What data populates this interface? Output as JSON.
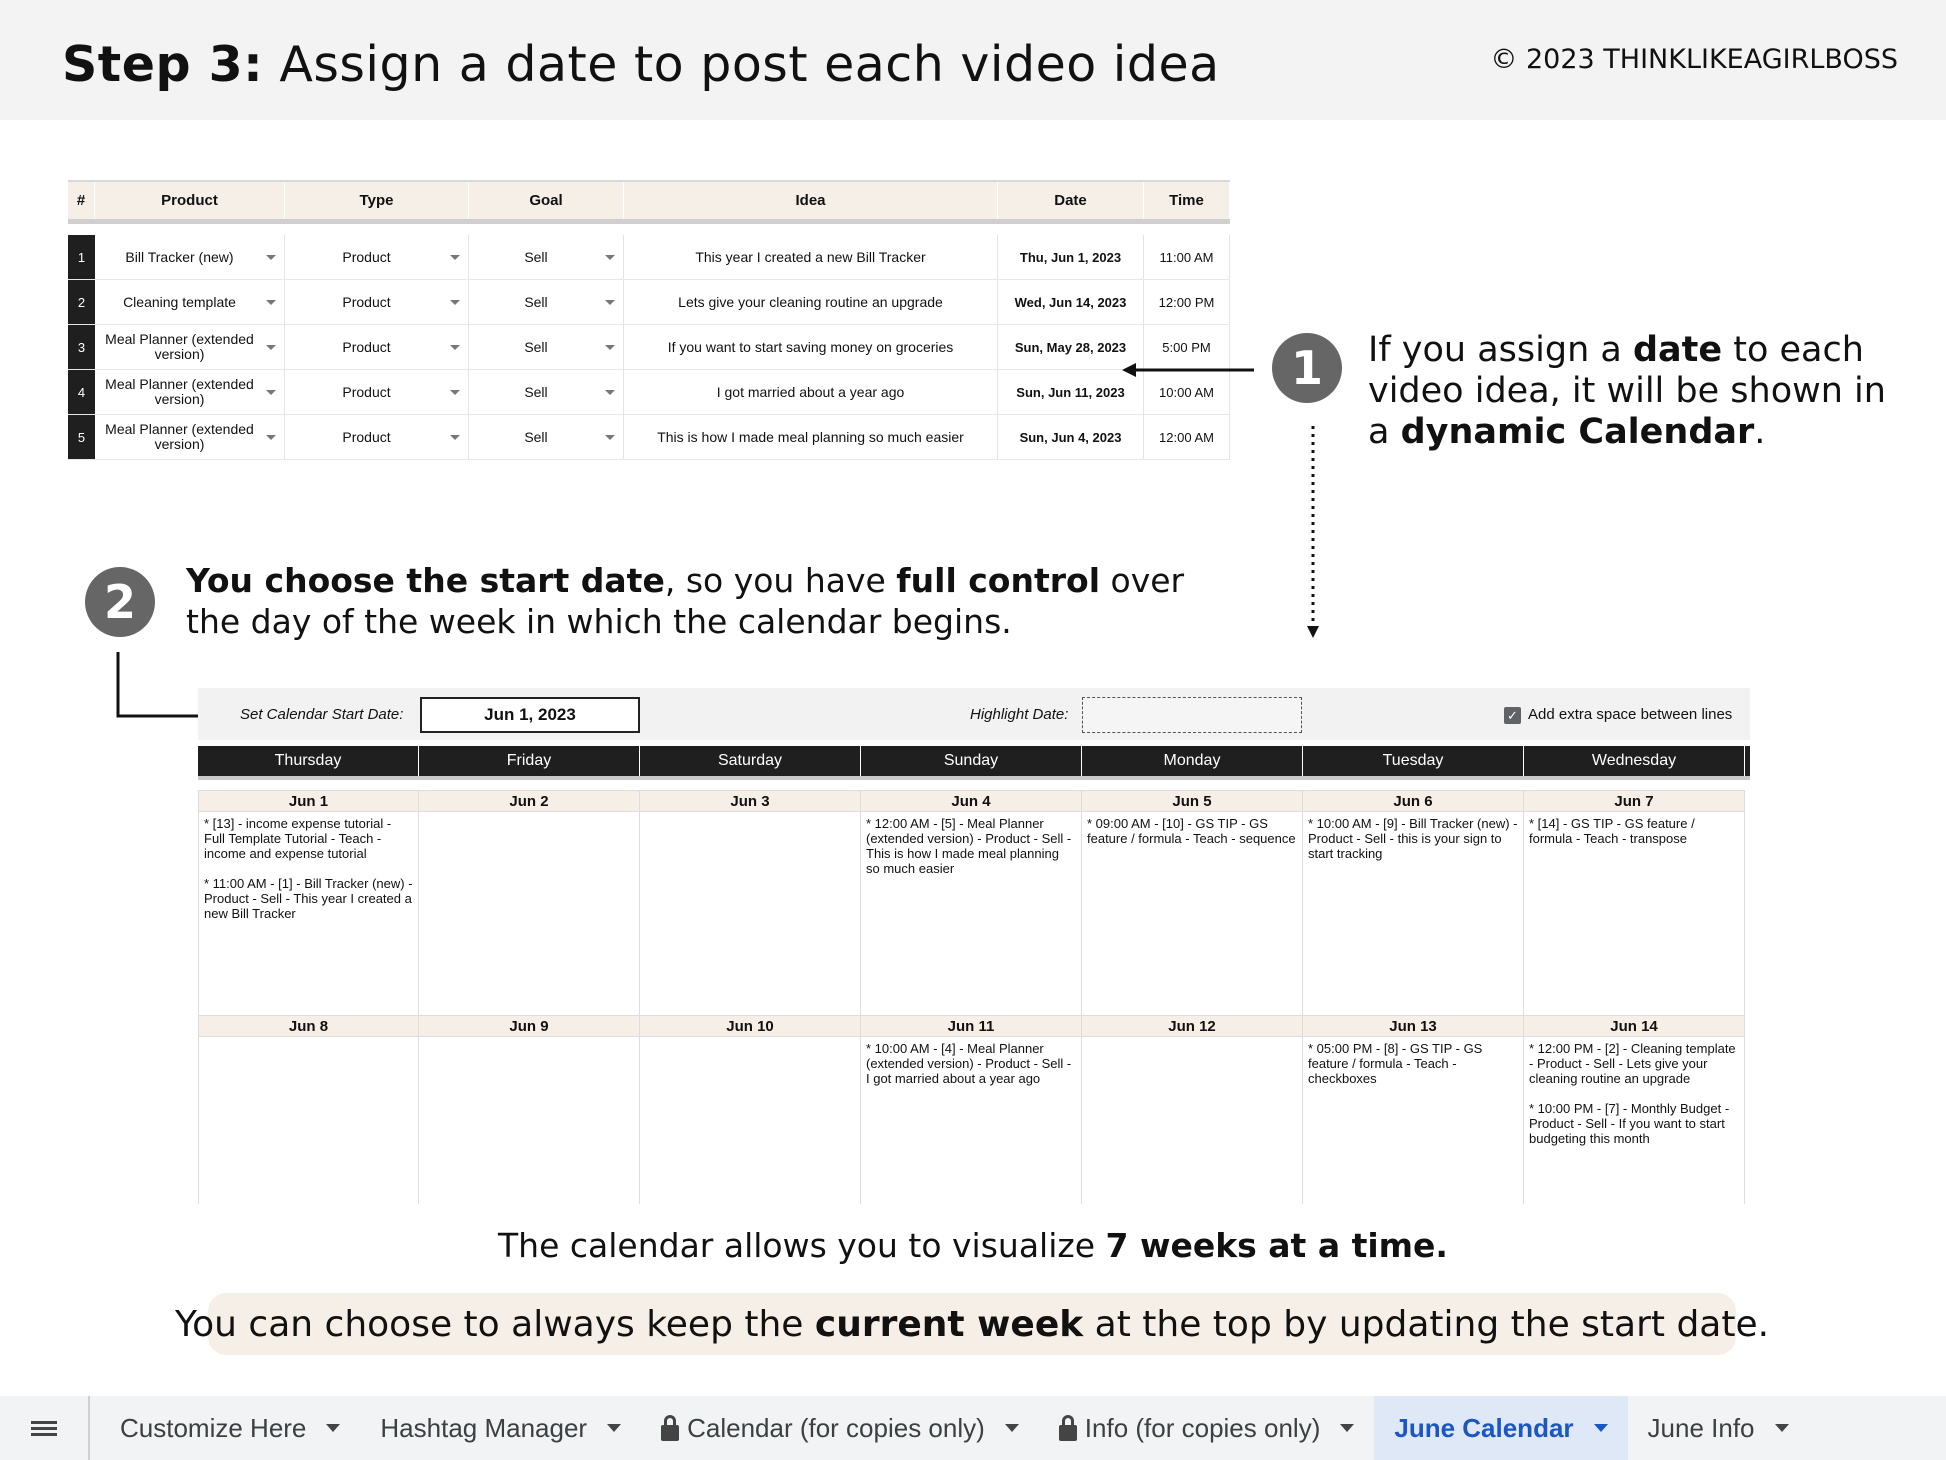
{
  "header": {
    "step_label": "Step 3:",
    "step_text": "Assign a date to post each video idea",
    "copyright": "©  2023 THINKLIKEAGIRLBOSS"
  },
  "table": {
    "headers": [
      "#",
      "Product",
      "Type",
      "Goal",
      "Idea",
      "Date",
      "Time"
    ],
    "rows": [
      {
        "num": "1",
        "product": "Bill Tracker (new)",
        "type": "Product",
        "goal": "Sell",
        "idea": "This year I created a new Bill Tracker",
        "date": "Thu, Jun 1, 2023",
        "time": "11:00 AM"
      },
      {
        "num": "2",
        "product": "Cleaning template",
        "type": "Product",
        "goal": "Sell",
        "idea": "Lets give your cleaning routine an upgrade",
        "date": "Wed, Jun 14, 2023",
        "time": "12:00 PM"
      },
      {
        "num": "3",
        "product": "Meal Planner (extended version)",
        "type": "Product",
        "goal": "Sell",
        "idea": "If you want to start saving money on groceries",
        "date": "Sun, May 28, 2023",
        "time": "5:00 PM"
      },
      {
        "num": "4",
        "product": "Meal Planner (extended version)",
        "type": "Product",
        "goal": "Sell",
        "idea": "I got married about a year ago",
        "date": "Sun, Jun 11, 2023",
        "time": "10:00 AM"
      },
      {
        "num": "5",
        "product": "Meal Planner (extended version)",
        "type": "Product",
        "goal": "Sell",
        "idea": "This is how I made meal planning so much easier",
        "date": "Sun, Jun 4, 2023",
        "time": "12:00 AM"
      }
    ]
  },
  "callout1": {
    "number": "1",
    "t1": "If you assign a ",
    "b1": "date",
    "t2": " to each video idea, it will be shown in a ",
    "b2": "dynamic Calendar",
    "t3": "."
  },
  "callout2": {
    "number": "2",
    "b1": "You choose the start date",
    "t1": ", so you have ",
    "b2": "full control",
    "t2": " over the day of the week in which the calendar begins."
  },
  "calendar": {
    "start_label": "Set Calendar Start Date:",
    "start_value": "Jun 1, 2023",
    "highlight_label": "Highlight Date:",
    "extra_space_label": "Add extra space between lines",
    "extra_space_checked": true,
    "days": [
      "Thursday",
      "Friday",
      "Saturday",
      "Sunday",
      "Monday",
      "Tuesday",
      "Wednesday"
    ],
    "weeks": [
      [
        {
          "date": "Jun 1",
          "events": [
            "* [13] - income expense tutorial - Full Template Tutorial - Teach - income and expense tutorial",
            "* 11:00 AM - [1] - Bill Tracker (new) - Product - Sell - This year I created a new Bill Tracker"
          ]
        },
        {
          "date": "Jun 2",
          "events": []
        },
        {
          "date": "Jun 3",
          "events": []
        },
        {
          "date": "Jun 4",
          "events": [
            "* 12:00 AM - [5] - Meal Planner (extended version) - Product - Sell - This is how I made meal planning so much easier"
          ]
        },
        {
          "date": "Jun 5",
          "events": [
            "* 09:00 AM - [10] - GS TIP - GS feature / formula - Teach - sequence"
          ]
        },
        {
          "date": "Jun 6",
          "events": [
            "* 10:00 AM - [9] - Bill Tracker (new) - Product - Sell - this is your sign to start tracking"
          ]
        },
        {
          "date": "Jun 7",
          "events": [
            "* [14] - GS TIP - GS feature / formula - Teach - transpose"
          ]
        }
      ],
      [
        {
          "date": "Jun 8",
          "events": []
        },
        {
          "date": "Jun 9",
          "events": []
        },
        {
          "date": "Jun 10",
          "events": []
        },
        {
          "date": "Jun 11",
          "events": [
            "* 10:00 AM - [4] - Meal Planner (extended version) - Product - Sell - I got married about a year ago"
          ]
        },
        {
          "date": "Jun 12",
          "events": []
        },
        {
          "date": "Jun 13",
          "events": [
            "* 05:00 PM - [8] - GS TIP - GS feature / formula - Teach - checkboxes"
          ]
        },
        {
          "date": "Jun 14",
          "events": [
            "* 12:00 PM - [2] - Cleaning template - Product - Sell - Lets give your cleaning routine an upgrade",
            "* 10:00 PM - [7] - Monthly Budget - Product - Sell - If you want to start budgeting this month"
          ]
        }
      ]
    ]
  },
  "summary": {
    "t1": "The calendar allows you to visualize ",
    "b1": "7 weeks at a time."
  },
  "tip": {
    "t1": "You can choose to always keep the ",
    "b1": "current week",
    "t2": " at the top by updating the start date."
  },
  "tabs": [
    {
      "label": "Customize Here",
      "locked": false,
      "active": false
    },
    {
      "label": "Hashtag Manager",
      "locked": false,
      "active": false
    },
    {
      "label": "Calendar (for copies only)",
      "locked": true,
      "active": false
    },
    {
      "label": "Info (for copies only)",
      "locked": true,
      "active": false
    },
    {
      "label": "June Calendar",
      "locked": false,
      "active": true
    },
    {
      "label": "June Info",
      "locked": false,
      "active": false
    }
  ],
  "colors": {
    "header_bg": "#f3f3f3",
    "table_header_bg": "#f6efe7",
    "badge": "#666666",
    "calendar_day_header": "#1f1f1f",
    "active_tab": "#1a56c4"
  }
}
